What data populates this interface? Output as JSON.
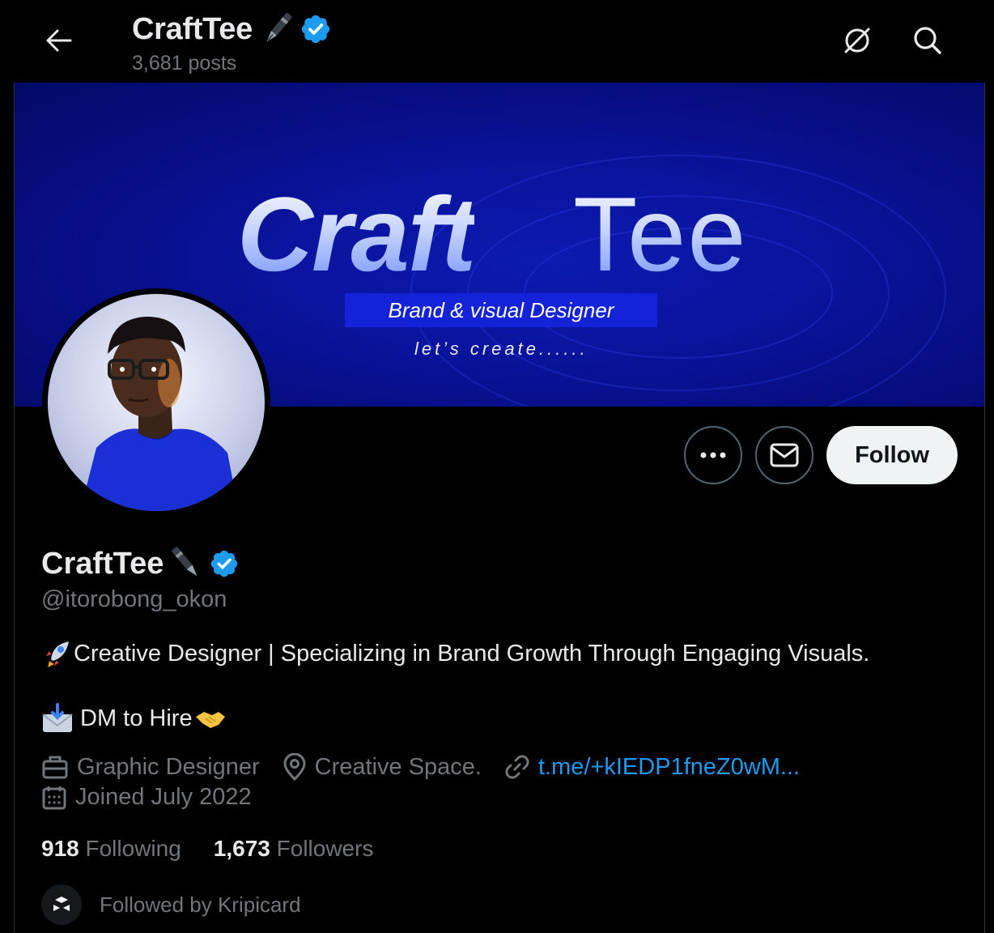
{
  "header": {
    "name": "CraftTee",
    "posts": "3,681 posts"
  },
  "banner": {
    "brand_bold": "Craft",
    "brand_light": "Tee",
    "tagline": "Brand & visual Designer",
    "subline": "let’s create......"
  },
  "profile": {
    "name": "CraftTee",
    "handle": "@itorobong_okon",
    "bio_line1": "Creative Designer | Specializing in Brand Growth Through Engaging Visuals.",
    "bio_line2": "DM to Hire",
    "profession": "Graphic Designer",
    "location": "Creative Space.",
    "link": "t.me/+kIEDP1fneZ0wM...",
    "joined": "Joined July 2022",
    "following_count": "918",
    "following_label": "Following",
    "followers_count": "1,673",
    "followers_label": "Followers",
    "followed_by": "Followed by Kripicard"
  },
  "actions": {
    "follow_label": "Follow"
  },
  "colors": {
    "background": "#000000",
    "verified": "#1d9bf0",
    "link": "#1d9bf0",
    "muted": "#71767b",
    "banner": "#0a149e"
  },
  "icons": [
    "back-arrow-icon",
    "grok-icon",
    "search-icon",
    "pen-emoji-icon",
    "verified-badge-icon",
    "more-icon",
    "message-icon",
    "rocket-emoji-icon",
    "inbox-emoji-icon",
    "handshake-emoji-icon",
    "briefcase-icon",
    "location-icon",
    "link-icon",
    "calendar-icon"
  ]
}
